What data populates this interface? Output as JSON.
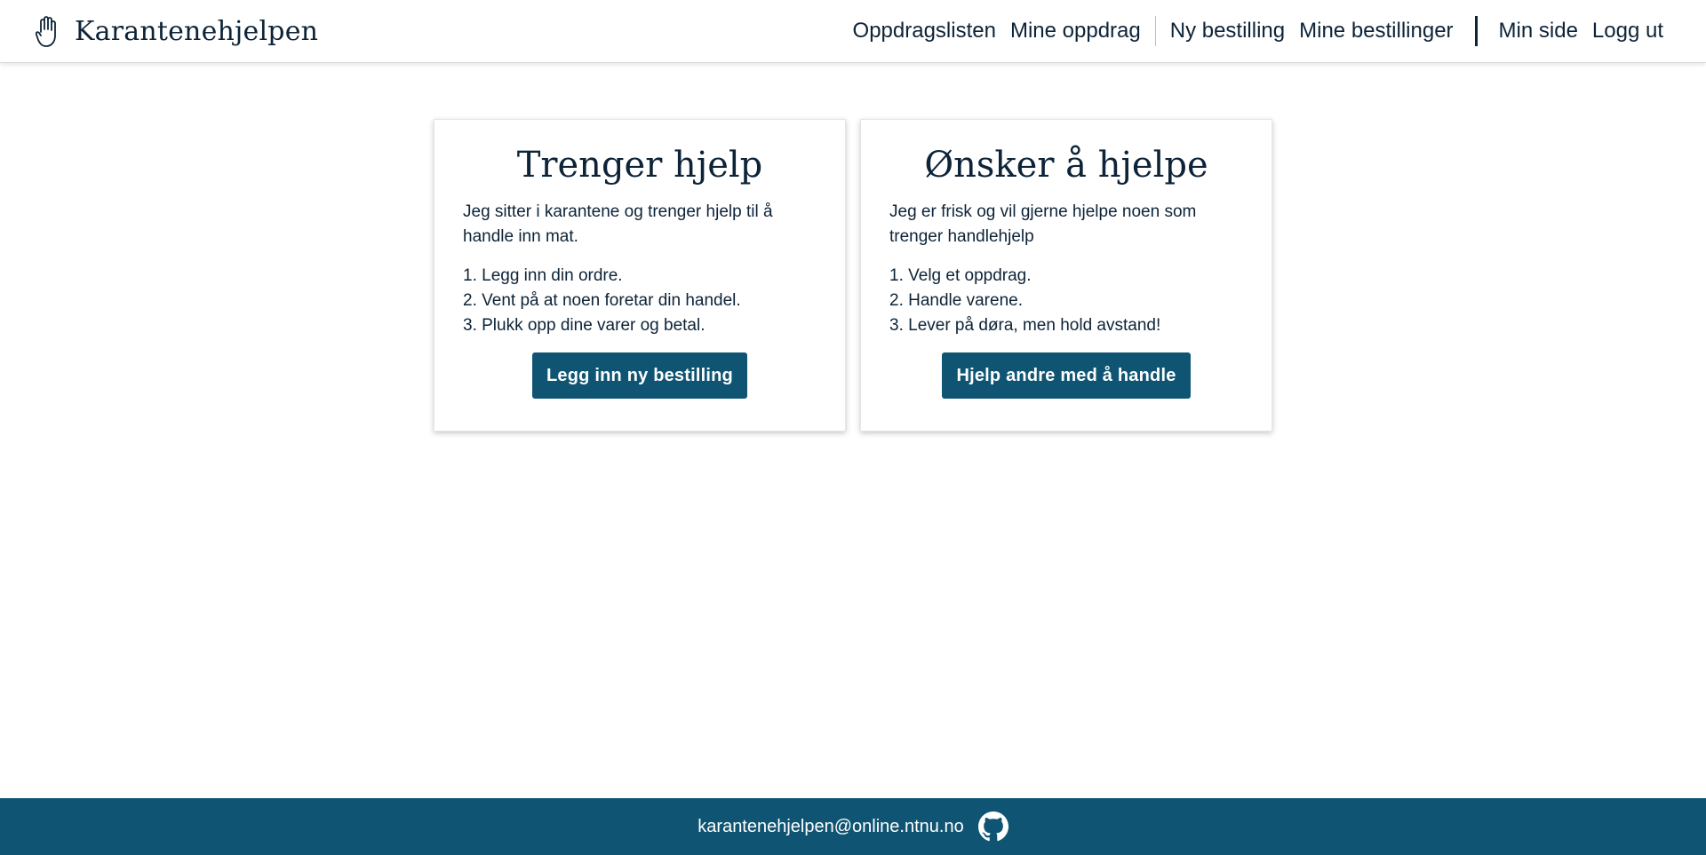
{
  "header": {
    "brand_name": "Karantenehjelpen",
    "brand_icon": "raised-hand-icon",
    "nav": {
      "oppdragslisten": "Oppdragslisten",
      "mine_oppdrag": "Mine oppdrag",
      "ny_bestilling": "Ny bestilling",
      "mine_bestillinger": "Mine bestillinger",
      "min_side": "Min side",
      "logg_ut": "Logg ut"
    }
  },
  "cards": {
    "need_help": {
      "title": "Trenger hjelp",
      "description": "Jeg sitter i karantene og trenger hjelp til å handle inn mat.",
      "steps": [
        "Legg inn din ordre.",
        "Vent på at noen foretar din handel.",
        "Plukk opp dine varer og betal."
      ],
      "button_label": "Legg inn ny bestilling"
    },
    "want_to_help": {
      "title": "Ønsker å hjelpe",
      "description": "Jeg er frisk og vil gjerne hjelpe noen som trenger handlehjelp",
      "steps": [
        "Velg et oppdrag.",
        "Handle varene.",
        "Lever på døra, men hold avstand!"
      ],
      "button_label": "Hjelp andre med å handle"
    }
  },
  "footer": {
    "email": "karantenehjelpen@online.ntnu.no",
    "github_icon": "github-icon"
  },
  "colors": {
    "primary": "#0f5573",
    "text": "#0d2338",
    "background": "#ffffff"
  }
}
